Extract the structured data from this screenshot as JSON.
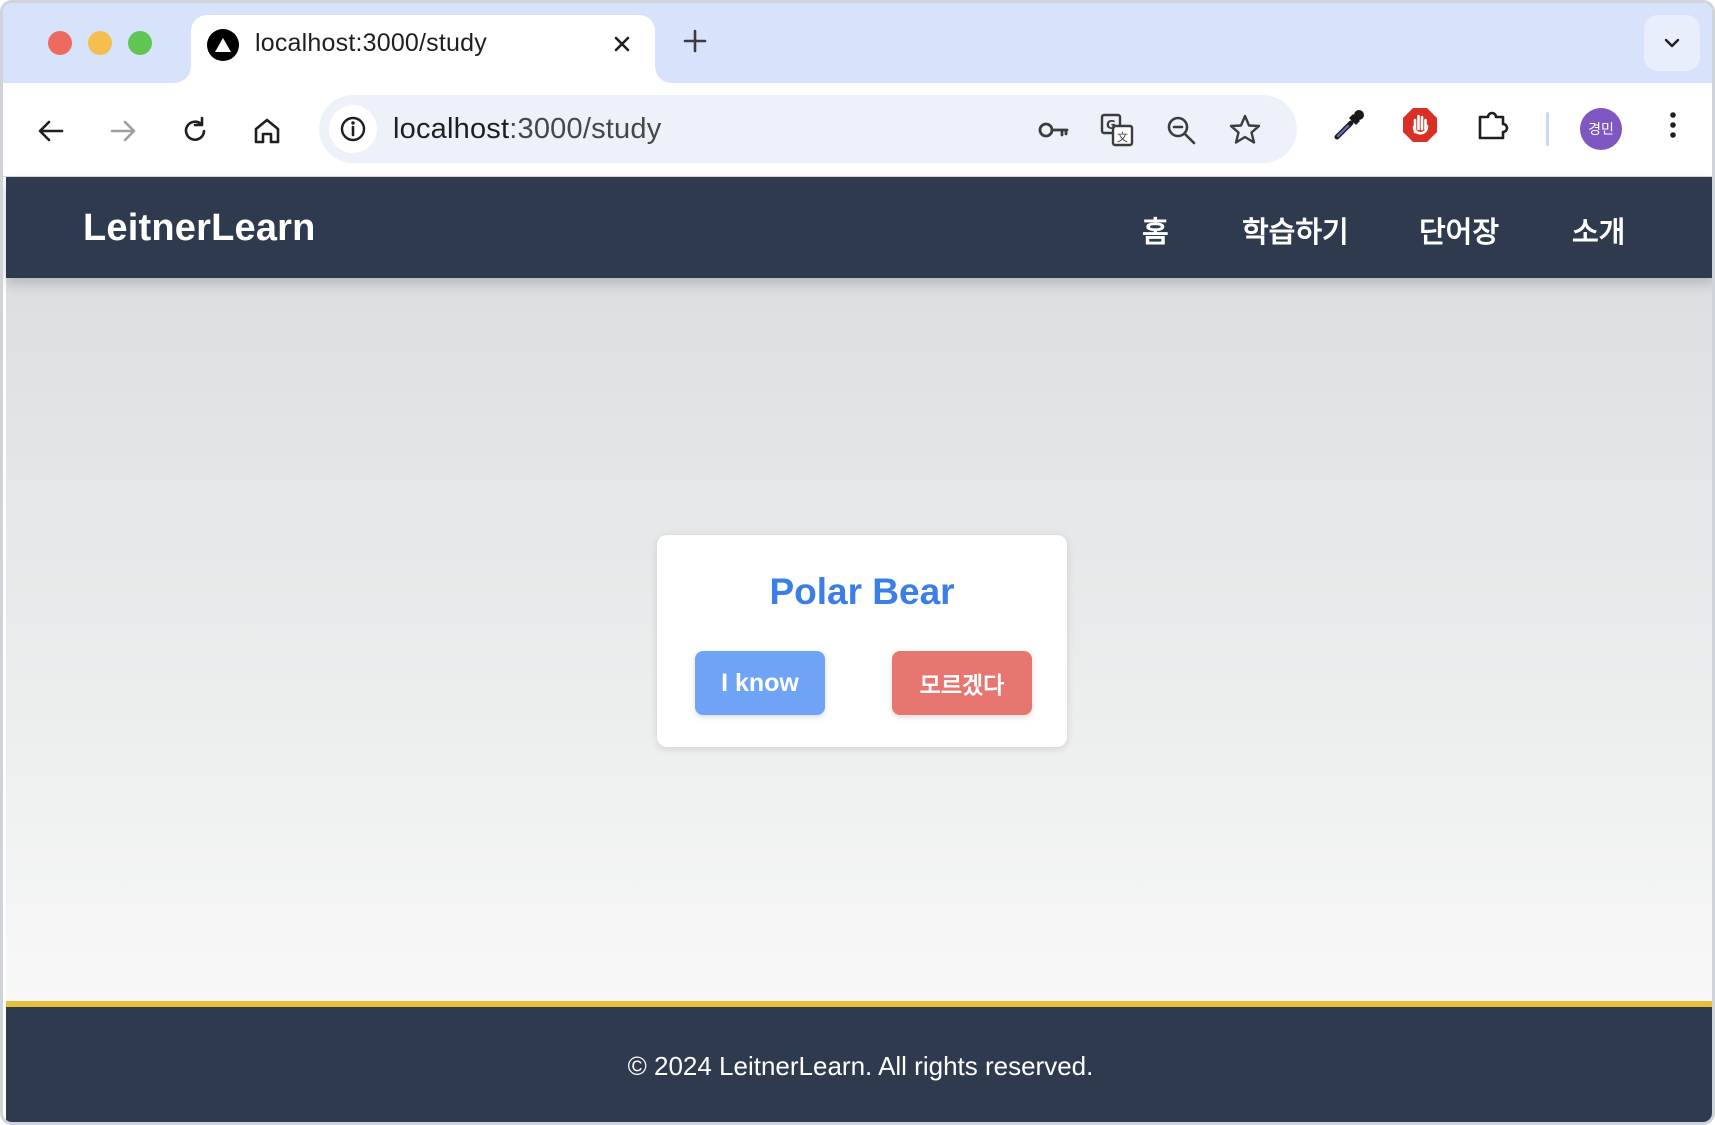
{
  "browser": {
    "tab_title": "localhost:3000/study",
    "url_host": "localhost",
    "url_path": ":3000/study",
    "profile_initials": "경민",
    "icons": [
      "back-icon",
      "forward-icon",
      "reload-icon",
      "home-icon",
      "site-info-icon",
      "password-key-icon",
      "translate-icon",
      "zoom-out-icon",
      "bookmark-star-icon",
      "eyedropper-icon",
      "adblock-icon",
      "extensions-icon",
      "more-menu-icon"
    ]
  },
  "header": {
    "brand": "LeitnerLearn",
    "nav": [
      {
        "label": "홈"
      },
      {
        "label": "학습하기"
      },
      {
        "label": "단어장"
      },
      {
        "label": "소개"
      }
    ]
  },
  "card": {
    "word": "Polar Bear",
    "know_label": "I know",
    "dont_know_label": "모르겠다"
  },
  "footer": {
    "text": "© 2024 LeitnerLearn. All rights reserved."
  },
  "colors": {
    "header_bg": "#2e3b4e",
    "word": "#3b7fe6",
    "know_button": "#6ea3f6",
    "dont_know_button": "#e77670",
    "footer_accent": "#e5c03b"
  }
}
